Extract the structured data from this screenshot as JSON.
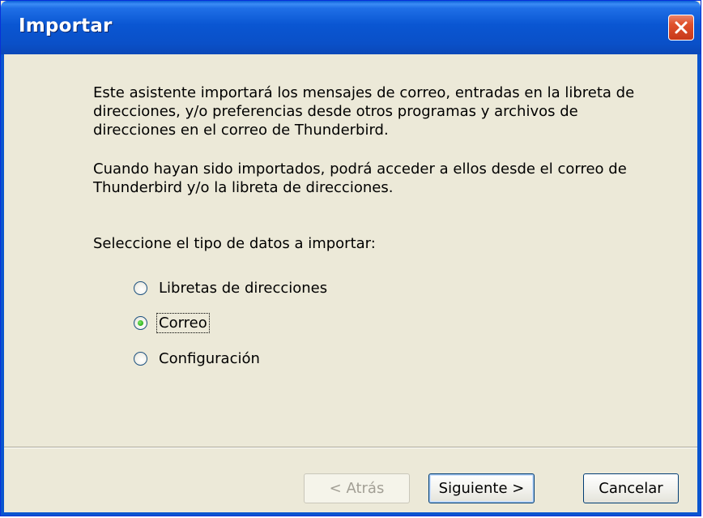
{
  "window": {
    "title": "Importar"
  },
  "content": {
    "paragraph1": "Este asistente importará los mensajes de correo, entradas en la libreta de direcciones, y/o preferencias desde otros programas y archivos de direcciones en el correo de Thunderbird.",
    "paragraph2": "Cuando hayan sido importados, podrá acceder a ellos desde el correo de Thunderbird y/o la libreta de direcciones.",
    "prompt": "Seleccione el tipo de datos a importar:"
  },
  "options": [
    {
      "label": "Libretas de direcciones",
      "selected": false
    },
    {
      "label": "Correo",
      "selected": true
    },
    {
      "label": "Configuración",
      "selected": false
    }
  ],
  "buttons": {
    "back": "< Atrás",
    "next": "Siguiente >",
    "cancel": "Cancelar"
  },
  "icons": {
    "close": "close-icon"
  },
  "colors": {
    "titlebar": "#0a56d2",
    "close_button": "#e0512c",
    "dialog_background": "#ece9d8",
    "radio_checked": "#2db01a"
  }
}
